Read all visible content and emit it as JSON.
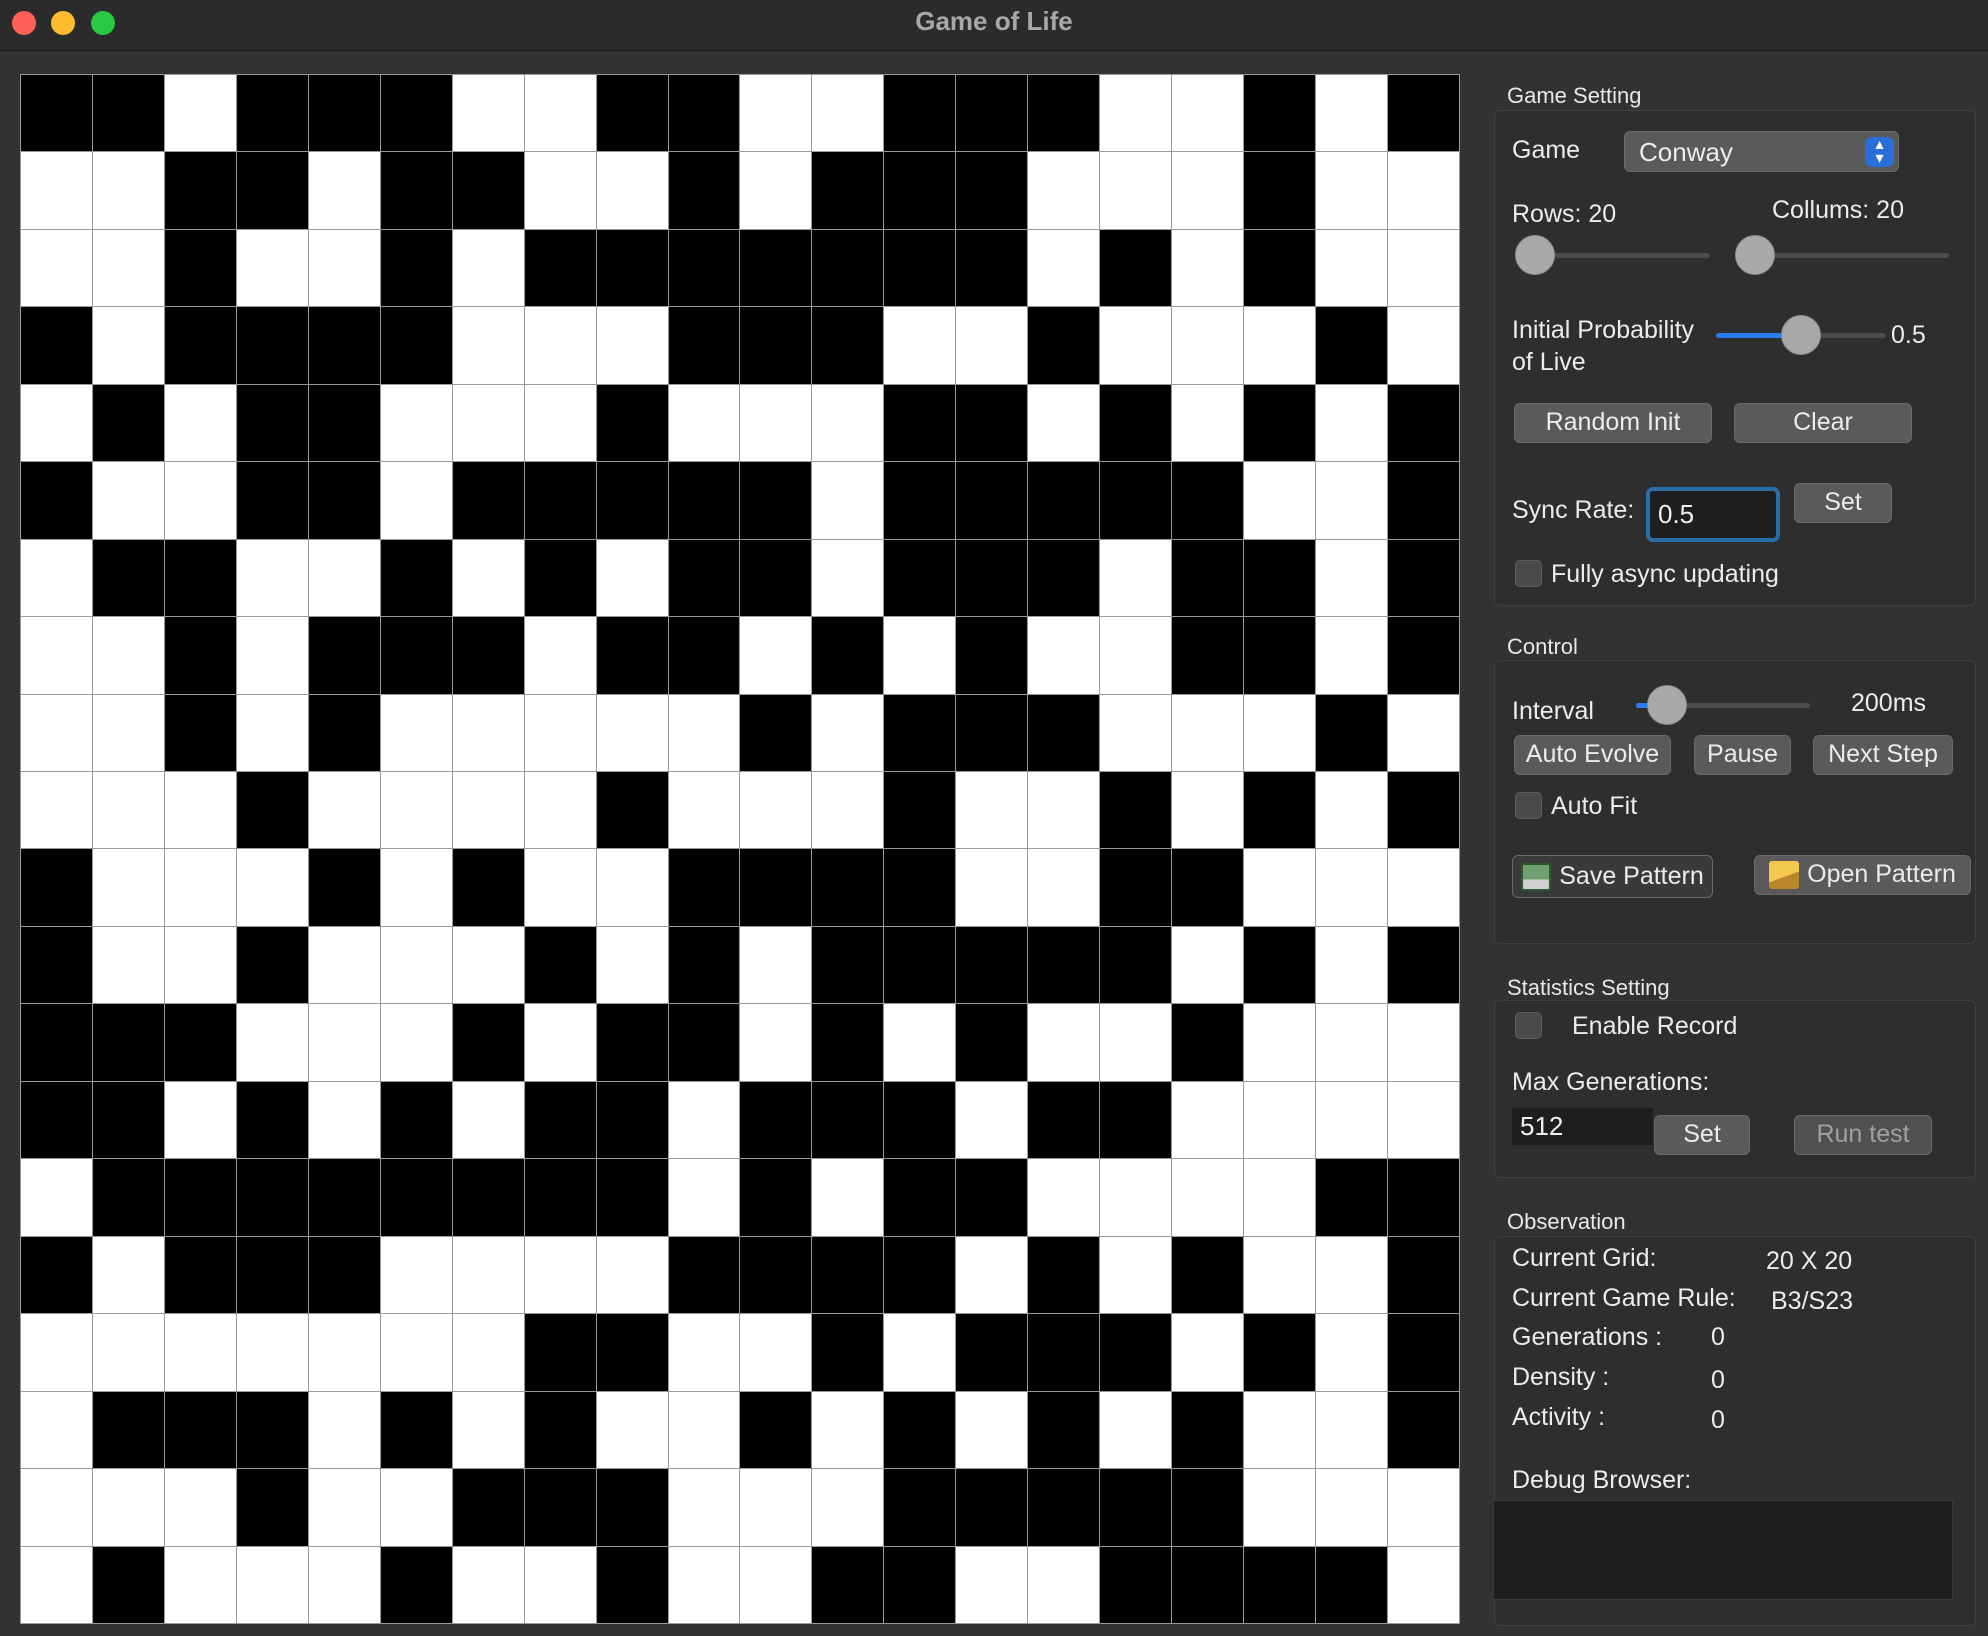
{
  "window": {
    "title": "Game of Life"
  },
  "grid": {
    "rows": 20,
    "cols": 20,
    "cells": [
      "11011100110011100101",
      "00110110010111000100",
      "00100101111111010100",
      "10111100011100100010",
      "01011000100011010101",
      "10011011111011111001",
      "01100101011011101101",
      "00101110110101001101",
      "00101000001011100010",
      "00010000100010010101",
      "10001010011110011000",
      "10010001010111110101",
      "11100010110101001000",
      "11010101101110110000",
      "01111111101011000011",
      "10111000011110101001",
      "00000001100101110101",
      "01110101001010101001",
      "00010011100011111000",
      "01000100100110011110"
    ]
  },
  "game_setting": {
    "section_title": "Game Setting",
    "game_label": "Game",
    "game_value": "Conway",
    "rows_label": "Rows: 20",
    "cols_label": "Collums: 20",
    "prob_label_line1": "Initial Probability",
    "prob_label_line2": "of Live",
    "prob_value": "0.5",
    "prob_fraction": 0.5,
    "random_init": "Random Init",
    "clear": "Clear",
    "sync_rate_label": "Sync Rate:",
    "sync_rate_value": "0.5",
    "set": "Set",
    "fully_async": "Fully async updating"
  },
  "control": {
    "section_title": "Control",
    "interval_label": "Interval",
    "interval_value": "200ms",
    "auto_evolve": "Auto Evolve",
    "pause": "Pause",
    "next_step": "Next Step",
    "auto_fit": "Auto Fit",
    "save_pattern": "Save Pattern",
    "open_pattern": "Open Pattern"
  },
  "statistics": {
    "section_title": "Statistics Setting",
    "enable_record": "Enable Record",
    "max_gen_label": "Max Generations:",
    "max_gen_value": "512",
    "set": "Set",
    "run_test": "Run test"
  },
  "observation": {
    "section_title": "Observation",
    "current_grid_label": "Current Grid:",
    "current_grid_value": "20 X 20",
    "rule_label": "Current Game Rule:",
    "rule_value": "B3/S23",
    "generations_label": "Generations :",
    "generations_value": "0",
    "density_label": "Density :",
    "density_value": "0",
    "activity_label": "Activity :",
    "activity_value": "0",
    "debug_label": "Debug Browser:"
  }
}
